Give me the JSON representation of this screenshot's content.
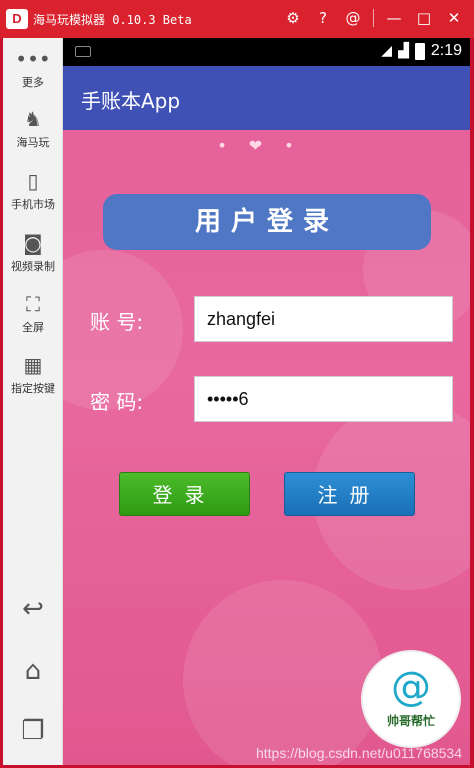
{
  "window": {
    "logo_text": "D",
    "title": "海马玩模拟器 0.10.3 Beta",
    "icons": [
      "gear-icon",
      "help-icon",
      "at-icon",
      "minimize-icon",
      "maximize-icon",
      "close-icon"
    ]
  },
  "sidebar": {
    "items": [
      {
        "label": "更多",
        "icon": "more-icon"
      },
      {
        "label": "海马玩",
        "icon": "haima-icon"
      },
      {
        "label": "手机市场",
        "icon": "market-icon"
      },
      {
        "label": "视频录制",
        "icon": "video-record-icon"
      },
      {
        "label": "全屏",
        "icon": "fullscreen-icon"
      },
      {
        "label": "指定按键",
        "icon": "keymap-icon"
      }
    ],
    "nav": [
      "back-icon",
      "home-icon",
      "recents-icon"
    ]
  },
  "status_bar": {
    "time": "2:19"
  },
  "app": {
    "title": "手账本App",
    "header": "用户登录",
    "account_label": "账    号:",
    "account_value": "zhangfei",
    "password_label": "密    码:",
    "password_value": "•••••6",
    "login_button": "登录",
    "register_button": "注册"
  },
  "badge": {
    "text": "帅哥帮忙"
  },
  "watermark": "https://blog.csdn.net/u011768534",
  "colors": {
    "titlebar": "#d9222e",
    "appbar": "#3f51b5",
    "login": "#3aa81d",
    "register": "#2580c8"
  }
}
